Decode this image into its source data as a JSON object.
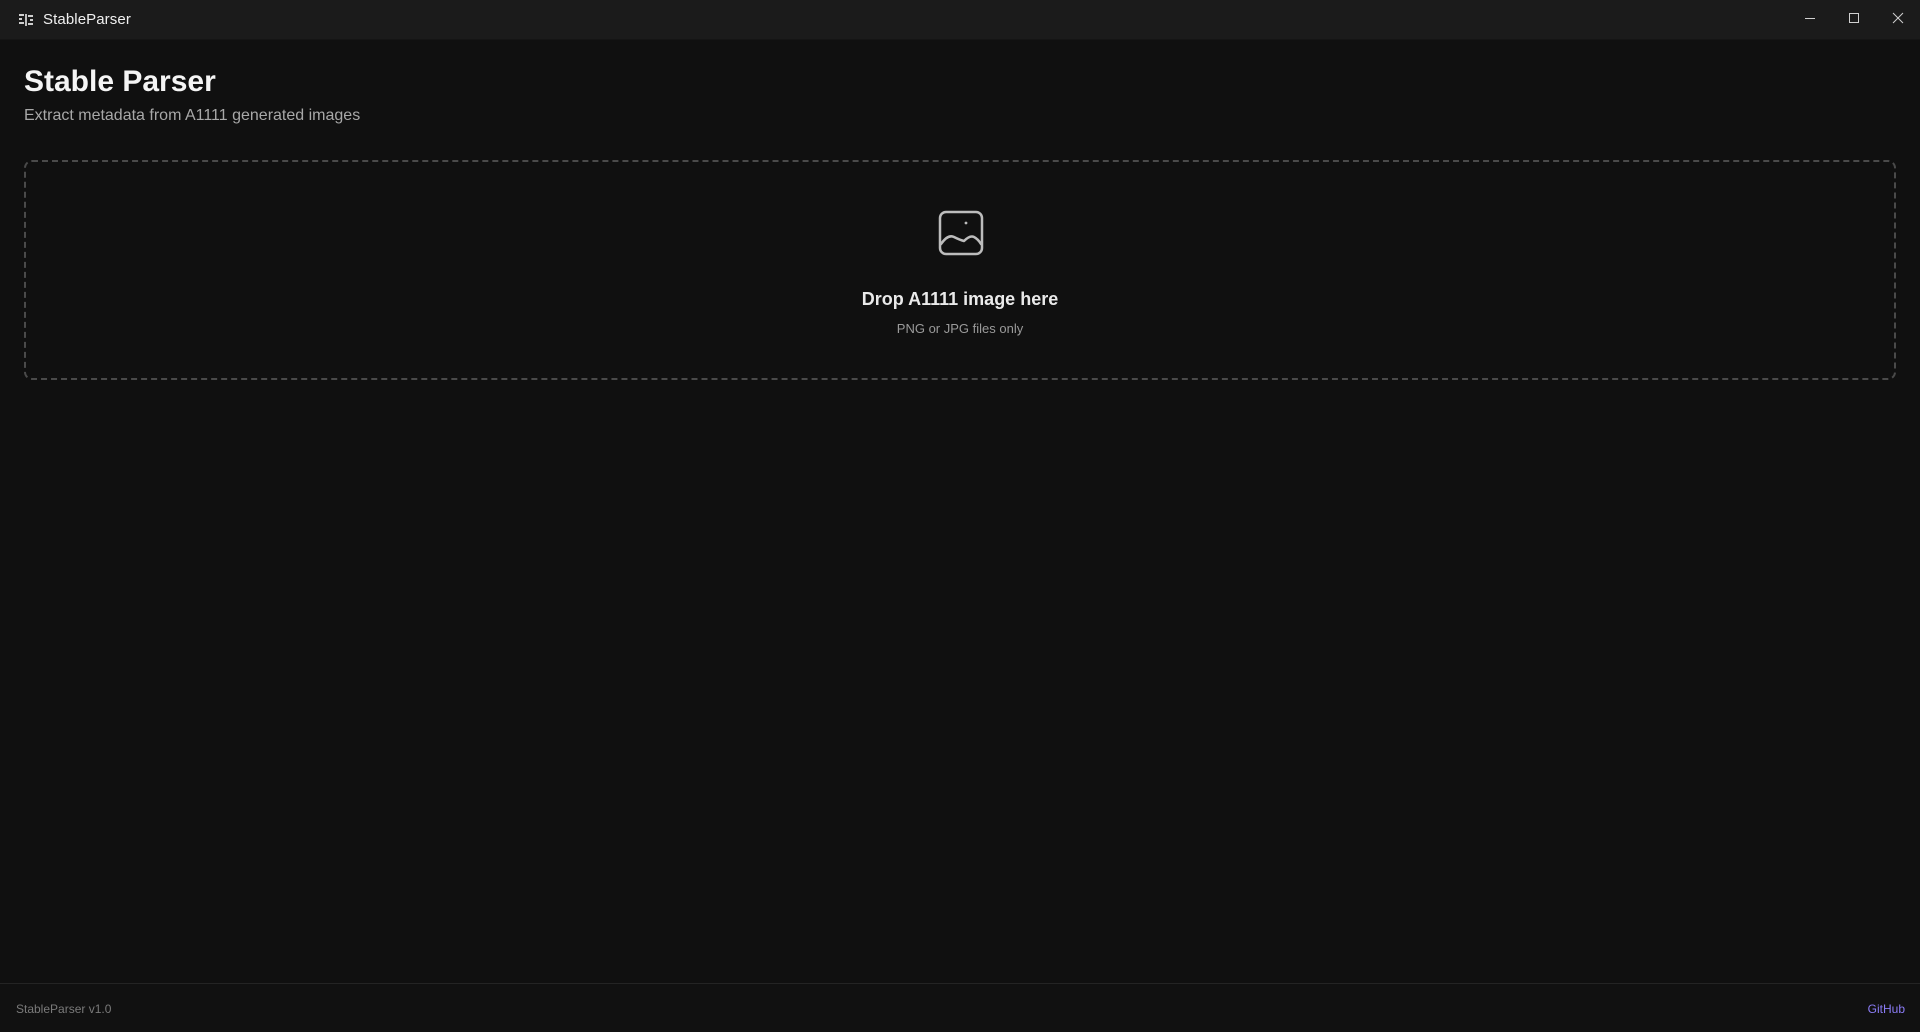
{
  "window": {
    "title": "StableParser",
    "controls": [
      "minimize-icon",
      "maximize-icon",
      "close-icon"
    ]
  },
  "header": {
    "title": "Stable Parser",
    "subtitle": "Extract metadata from A1111 generated images"
  },
  "dropzone": {
    "icon": "image-icon",
    "title": "Drop A1111 image here",
    "hint": "PNG or JPG files only"
  },
  "footer": {
    "version": "StableParser v1.0",
    "link_label": "GitHub"
  },
  "colors": {
    "background": "#101010",
    "titlebar": "#1b1b1b",
    "accent_link": "#8b7cf6"
  }
}
